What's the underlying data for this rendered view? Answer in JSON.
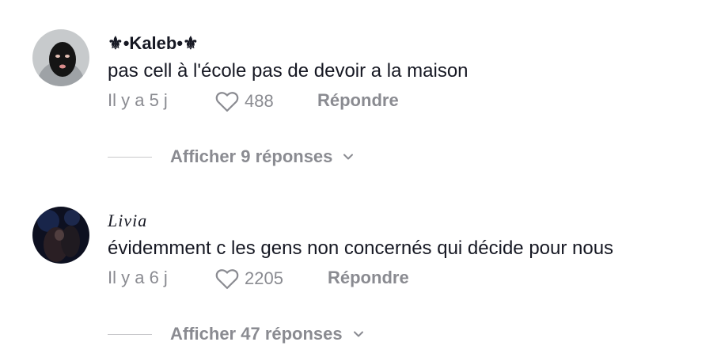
{
  "comments": [
    {
      "username": "⚜•Kaleb•⚜",
      "text": "pas cell à l'école pas de devoir a la maison",
      "time": "Il y a 5 j",
      "likes": "488",
      "reply_label": "Répondre",
      "view_replies": "Afficher 9 réponses"
    },
    {
      "username": "Livia",
      "text": "évidemment c les gens non concernés qui décide pour nous",
      "time": "Il y a 6 j",
      "likes": "2205",
      "reply_label": "Répondre",
      "view_replies": "Afficher 47 réponses"
    }
  ],
  "icons": {
    "like": "heart-outline-icon",
    "expand": "chevron-down-icon"
  },
  "colors": {
    "text": "#161823",
    "muted": "#8a8b91",
    "username_ornament": "#c9a227"
  }
}
